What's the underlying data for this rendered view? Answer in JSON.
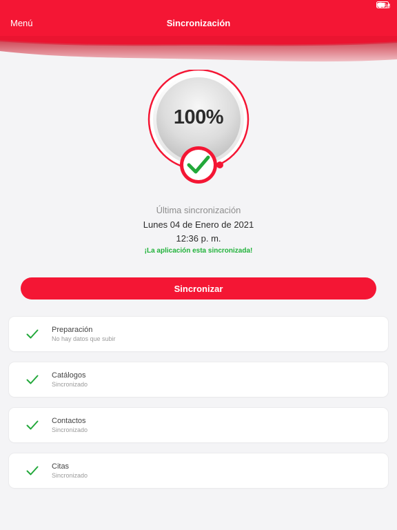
{
  "status_bar": {
    "battery": "68%"
  },
  "header": {
    "menu_label": "Menú",
    "title": "Sincronización",
    "accent": "#f41634"
  },
  "progress": {
    "label": "100%",
    "value": 100
  },
  "sync_info": {
    "last_sync_label": "Última sincronización",
    "date": "Lunes 04 de Enero de 2021",
    "time": "12:36 p. m.",
    "message": "¡La aplicación esta sincronizada!"
  },
  "sync_button": {
    "label": "Sincronizar"
  },
  "items": [
    {
      "title": "Preparación",
      "subtitle": "No hay datos que subir"
    },
    {
      "title": "Catálogos",
      "subtitle": "Sincronizado"
    },
    {
      "title": "Contactos",
      "subtitle": "Sincronizado"
    },
    {
      "title": "Citas",
      "subtitle": "Sincronizado"
    }
  ]
}
